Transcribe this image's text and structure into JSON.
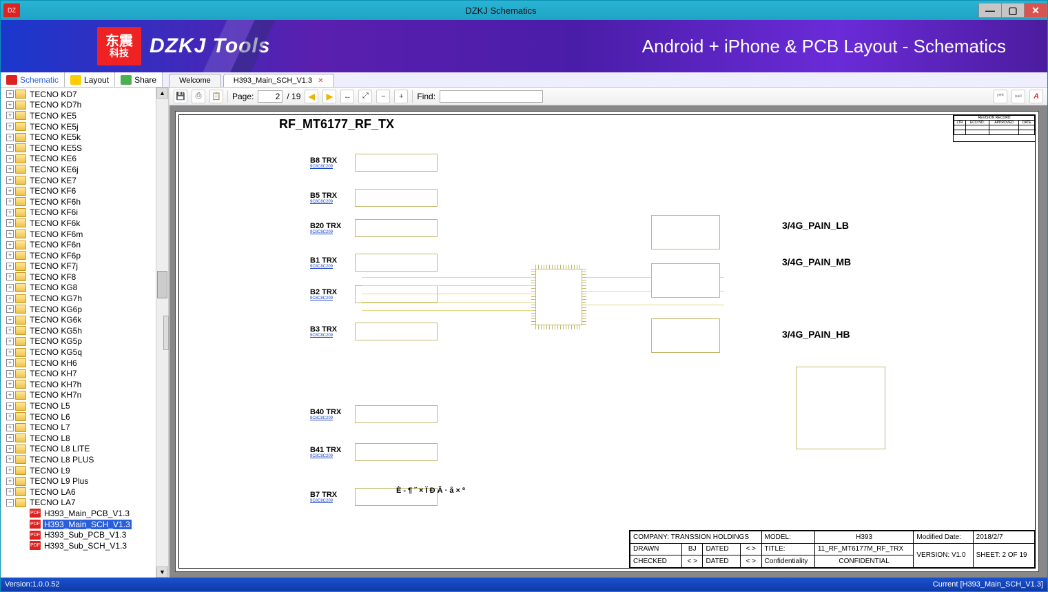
{
  "window": {
    "title": "DZKJ Schematics"
  },
  "banner": {
    "logo_text": "东震",
    "logo_sub": "科技",
    "brand": "DZKJ Tools",
    "tagline": "Android + iPhone & PCB Layout - Schematics"
  },
  "panel_tabs": {
    "schematic": "Schematic",
    "layout": "Layout",
    "share": "Share"
  },
  "doc_tabs": [
    {
      "label": "Welcome",
      "active": false
    },
    {
      "label": "H393_Main_SCH_V1.3",
      "active": true
    }
  ],
  "toolbar": {
    "page_label": "Page:",
    "page_current": "2",
    "page_total": "/ 19",
    "find_label": "Find:",
    "find_value": ""
  },
  "tree": {
    "folders": [
      "TECNO KD7",
      "TECNO KD7h",
      "TECNO KE5",
      "TECNO KE5j",
      "TECNO KE5k",
      "TECNO KE5S",
      "TECNO KE6",
      "TECNO KE6j",
      "TECNO KE7",
      "TECNO KF6",
      "TECNO KF6h",
      "TECNO KF6i",
      "TECNO KF6k",
      "TECNO KF6m",
      "TECNO KF6n",
      "TECNO KF6p",
      "TECNO KF7j",
      "TECNO KF8",
      "TECNO KG8",
      "TECNO KG7h",
      "TECNO KG6p",
      "TECNO KG6k",
      "TECNO KG5h",
      "TECNO KG5p",
      "TECNO KG5q",
      "TECNO KH6",
      "TECNO KH7",
      "TECNO KH7h",
      "TECNO KH7n",
      "TECNO L5",
      "TECNO L6",
      "TECNO L7",
      "TECNO L8",
      "TECNO L8 LITE",
      "TECNO L8 PLUS",
      "TECNO L9",
      "TECNO L9 Plus",
      "TECNO LA6"
    ],
    "open_folder": "TECNO LA7",
    "children": [
      "H393_Main_PCB_V1.3",
      "H393_Main_SCH_V1.3",
      "H393_Sub_PCB_V1.3",
      "H393_Sub_SCH_V1.3"
    ],
    "selected_child": "H393_Main_SCH_V1.3"
  },
  "schematic": {
    "title": "RF_MT6177_RF_TX",
    "blocks": [
      "B8 TRX",
      "B5 TRX",
      "B20 TRX",
      "B1 TRX",
      "B2 TRX",
      "B3 TRX",
      "B40 TRX",
      "B41 TRX",
      "B7 TRX"
    ],
    "right_blocks": [
      "3/4G_PAIN_LB",
      "3/4G_PAIN_MB",
      "3/4G_PAIN_HB"
    ],
    "symbol_line": "È - ¶ ˝ × Ï Ð Â · å × º"
  },
  "title_block": {
    "company_lbl": "COMPANY:",
    "company": "TRANSSION HOLDINGS",
    "model_lbl": "MODEL:",
    "model": "H393",
    "moddate_lbl": "Modified Date:",
    "moddate": "2018/2/7",
    "drawn_lbl": "DRAWN",
    "drawn": "BJ",
    "dated_lbl": "DATED",
    "dated": "< >",
    "title_lbl": "TITLE:",
    "title": "11_RF_MT6177M_RF_TRX",
    "version_lbl": "VERSION:",
    "version": "V1.0",
    "checked_lbl": "CHECKED",
    "checked": "< >",
    "conf_lbl": "Confidentiality",
    "conf": "CONFIDENTIAL",
    "sheet_lbl": "SHEET:",
    "sheet": "2  OF  19"
  },
  "rev": {
    "hdr": "REVISION RECORD",
    "c1": "LTR",
    "c2": "ECO NO.",
    "c3": "APPROVED",
    "c4": "DATE"
  },
  "status": {
    "left": "Version:1.0.0.52",
    "right": "Current [H393_Main_SCH_V1.3]"
  }
}
